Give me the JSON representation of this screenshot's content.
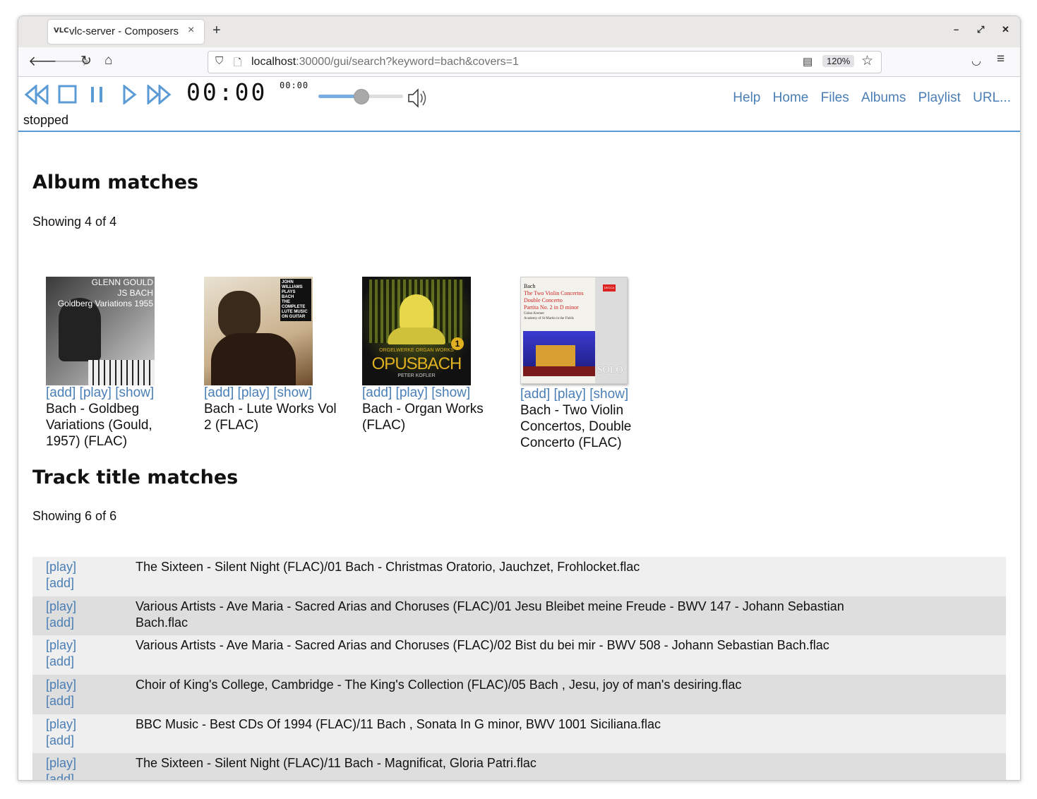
{
  "browser": {
    "tab_favicon": "VLC",
    "tab_title": "vlc-server - Composers",
    "tab_close": "×",
    "new_tab": "+",
    "win_min": "–",
    "win_restore": "⤢",
    "win_close": "✕",
    "url_host": "localhost",
    "url_rest": ":30000/gui/search?keyword=bach&covers=1",
    "zoom": "120%"
  },
  "player": {
    "time": "00:00",
    "time_small": "00:00",
    "status": "stopped",
    "volume": 0.5
  },
  "nav": {
    "help": "Help",
    "home": "Home",
    "files": "Files",
    "albums": "Albums",
    "playlist": "Playlist",
    "url": "URL..."
  },
  "albums": {
    "heading": "Album matches",
    "showing": "Showing 4 of 4",
    "items": [
      {
        "links": "[add] [play] [show]",
        "title": "Bach - Goldbeg Variations (Gould, 1957) (FLAC)",
        "cover_text": [
          "GLENN GOULD",
          "JS BACH",
          "Goldberg Variations 1955"
        ]
      },
      {
        "links": "[add] [play] [show]",
        "title": "Bach - Lute Works Vol 2 (FLAC)",
        "cover_text": [
          "JOHN",
          "WILLIAMS",
          "PLAYS",
          "BACH",
          "THE",
          "COMPLETE",
          "LUTE MUSIC",
          "ON GUITAR"
        ]
      },
      {
        "links": "[add] [play] [show]",
        "title": "Bach - Organ Works (FLAC)",
        "cover_text": [
          "ORGELWERKE ORGAN WORKS",
          "OPUSBACH",
          "PETER KOFLER",
          "1"
        ]
      },
      {
        "links": "[add] [play] [show]",
        "title": "Bach - Two Violin Concertos, Double Concerto (FLAC)",
        "cover_text": [
          "Bach",
          "The Two Violin Concertos",
          "Double Concerto",
          "Partita No. 2 in D minor",
          "Gidon Kremer",
          "Academy of St Martin in the Fields",
          "SOLO",
          "DECCA"
        ]
      }
    ]
  },
  "tracks": {
    "heading": "Track title matches",
    "showing": "Showing 6 of 6",
    "play_label": "[play]",
    "add_label": "[add]",
    "items": [
      "The Sixteen - Silent Night (FLAC)/01 Bach - Christmas Oratorio, Jauchzet, Frohlocket.flac",
      "Various Artists - Ave Maria - Sacred Arias and Choruses (FLAC)/01 Jesu Bleibet meine Freude - BWV 147 - Johann Sebastian Bach.flac",
      "Various Artists - Ave Maria - Sacred Arias and Choruses (FLAC)/02 Bist du bei mir - BWV 508 - Johann Sebastian Bach.flac",
      "Choir of King's College, Cambridge - The King's Collection (FLAC)/05 Bach , Jesu, joy of man's desiring.flac",
      "BBC Music - Best CDs Of 1994 (FLAC)/11 Bach , Sonata In G minor, BWV 1001 Siciliana.flac",
      "The Sixteen - Silent Night (FLAC)/11 Bach - Magnificat, Gloria Patri.flac"
    ]
  },
  "colors": {
    "link": "#4a7eb5",
    "player_control": "#5b9bd5",
    "row_odd": "#efefef",
    "row_even": "#dedede"
  }
}
